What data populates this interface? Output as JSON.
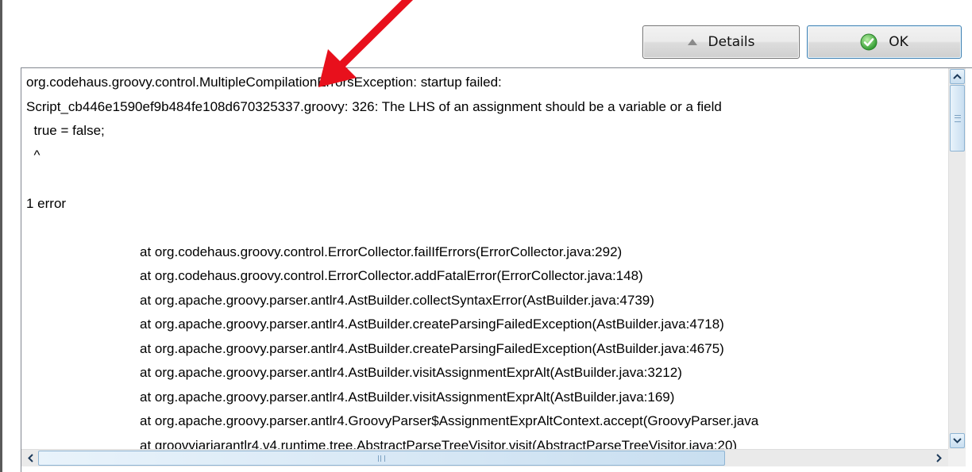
{
  "buttons": {
    "details_label": "Details",
    "ok_label": "OK"
  },
  "error_text": {
    "lines": [
      "org.codehaus.groovy.control.MultipleCompilationErrorsException: startup failed:",
      "Script_cb446e1590ef9b484fe108d670325337.groovy: 326: The LHS of an assignment should be a variable or a field",
      "  true = false;",
      "  ^",
      "",
      "1 error",
      "",
      "\t\tat org.codehaus.groovy.control.ErrorCollector.failIfErrors(ErrorCollector.java:292)",
      "\t\tat org.codehaus.groovy.control.ErrorCollector.addFatalError(ErrorCollector.java:148)",
      "\t\tat org.apache.groovy.parser.antlr4.AstBuilder.collectSyntaxError(AstBuilder.java:4739)",
      "\t\tat org.apache.groovy.parser.antlr4.AstBuilder.createParsingFailedException(AstBuilder.java:4718)",
      "\t\tat org.apache.groovy.parser.antlr4.AstBuilder.createParsingFailedException(AstBuilder.java:4675)",
      "\t\tat org.apache.groovy.parser.antlr4.AstBuilder.visitAssignmentExprAlt(AstBuilder.java:3212)",
      "\t\tat org.apache.groovy.parser.antlr4.AstBuilder.visitAssignmentExprAlt(AstBuilder.java:169)",
      "\t\tat org.apache.groovy.parser.antlr4.GroovyParser$AssignmentExprAltContext.accept(GroovyParser.java",
      "\t\tat groovyjarjarantlr4.v4.runtime.tree.AbstractParseTreeVisitor.visit(AbstractParseTreeVisitor.java:20)"
    ]
  },
  "icons": {
    "details_glyph": "triangle-up-icon",
    "ok_glyph": "check-circle-icon",
    "annotation": "red-arrow-icon"
  },
  "colors": {
    "annotation_arrow": "#e8101c",
    "ok_check": "#3aa13a",
    "button_border": "#707070",
    "scrollbar_accent": "#8eb4d3"
  }
}
